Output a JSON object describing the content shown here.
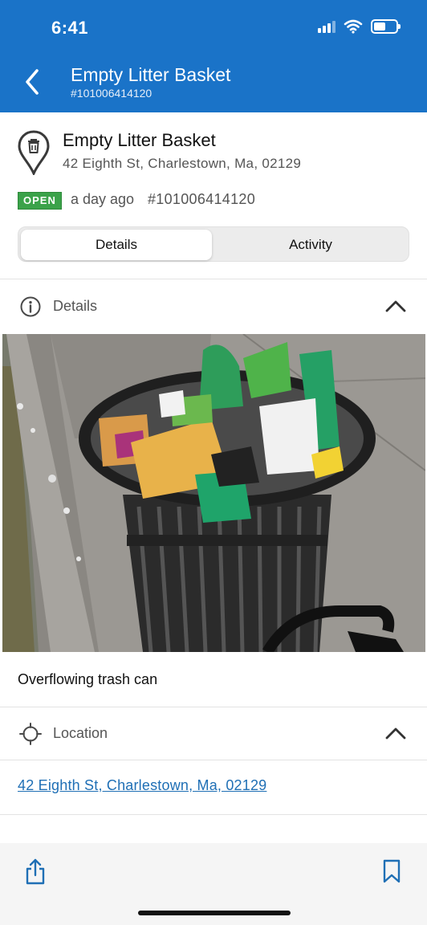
{
  "status_bar": {
    "time": "6:41",
    "battery_level": 0.55
  },
  "nav": {
    "title": "Empty Litter Basket",
    "subtitle": "#101006414120",
    "back_icon": "chevron-left-icon"
  },
  "request": {
    "title": "Empty Litter Basket",
    "address": "42 Eighth St, Charlestown, Ma, 02129",
    "status": "OPEN",
    "age": "a day ago",
    "id": "#101006414120",
    "icon": "trash-pin-icon"
  },
  "tabs": [
    {
      "label": "Details",
      "active": true
    },
    {
      "label": "Activity",
      "active": false
    }
  ],
  "details_section": {
    "label": "Details",
    "icon": "info-icon"
  },
  "photo": {
    "alt": "Overflowing trash can"
  },
  "description": "Overflowing trash can",
  "location_section": {
    "label": "Location",
    "icon": "crosshair-icon"
  },
  "location_link": "42 Eighth St, Charlestown, Ma, 02129",
  "bottom_bar": {
    "share_icon": "share-icon",
    "bookmark_icon": "bookmark-icon"
  },
  "colors": {
    "header": "#1a73c8",
    "status_open": "#3ba24a",
    "link": "#1f6fb5"
  }
}
